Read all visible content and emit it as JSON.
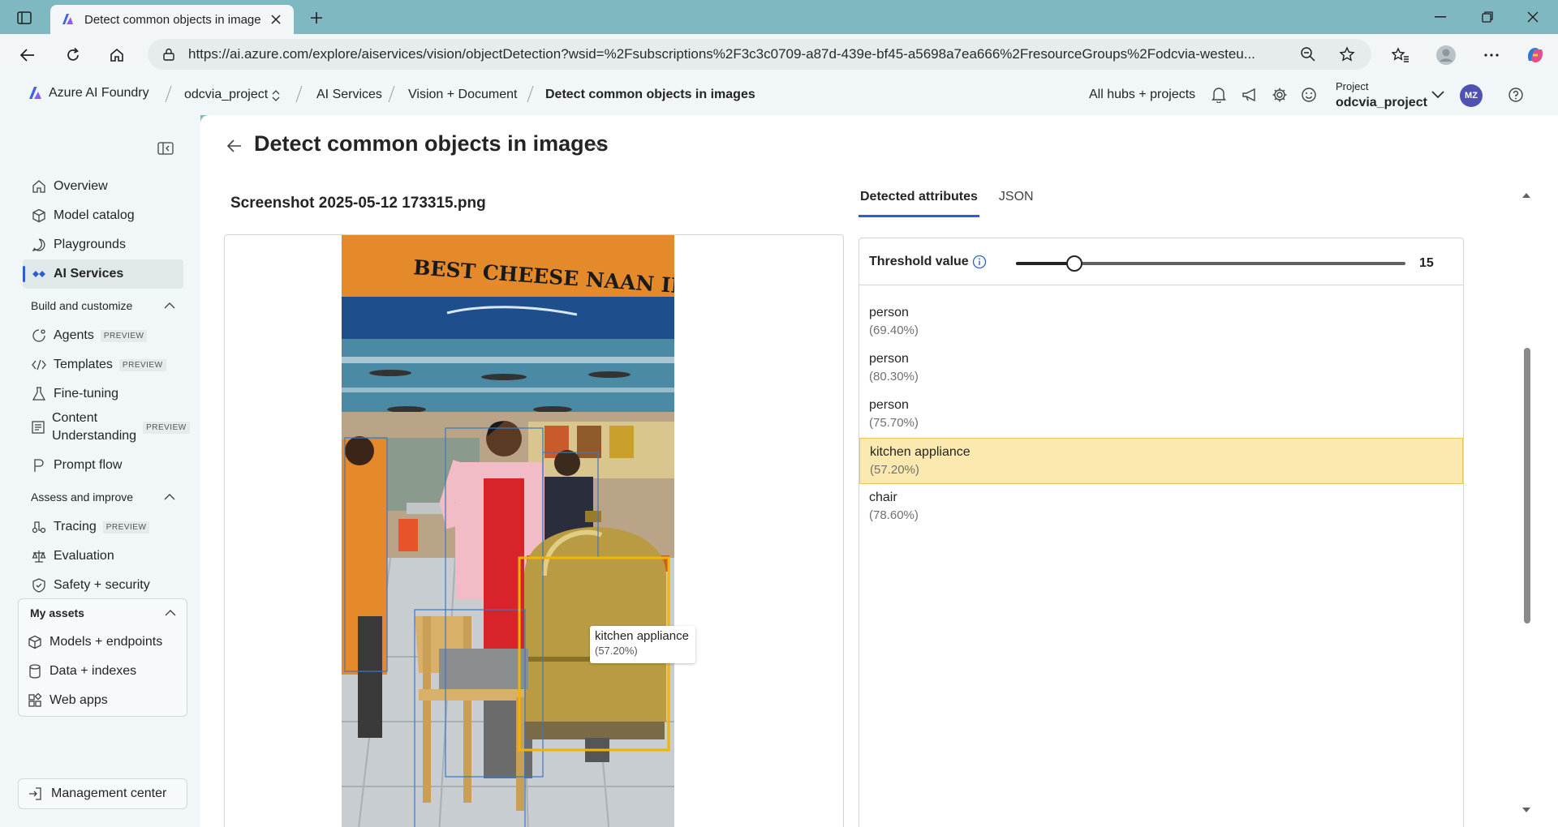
{
  "browser": {
    "tab_title": "Detect common objects in images",
    "url": "https://ai.azure.com/explore/aiservices/vision/objectDetection?wsid=%2Fsubscriptions%2F3c3c0709-a87d-439e-bf45-a5698a7ea666%2FresourceGroups%2Fodcvia-westeu..."
  },
  "header": {
    "brand": "Azure AI Foundry",
    "breadcrumbs": [
      "odcvia_project",
      "AI Services",
      "Vision + Document",
      "Detect common objects in images"
    ],
    "hubs_link": "All hubs + projects",
    "project_label": "Project",
    "project_name": "odcvia_project",
    "avatar_initials": "MZ"
  },
  "sidebar": {
    "items": [
      {
        "label": "Overview",
        "icon": "home-icon"
      },
      {
        "label": "Model catalog",
        "icon": "cube-icon"
      },
      {
        "label": "Playgrounds",
        "icon": "chat-icon"
      },
      {
        "label": "AI Services",
        "icon": "ai-services-icon",
        "active": true
      }
    ],
    "section_build": "Build and customize",
    "build_items": [
      {
        "label": "Agents",
        "badge": "PREVIEW"
      },
      {
        "label": "Templates",
        "badge": "PREVIEW"
      },
      {
        "label": "Fine-tuning"
      },
      {
        "label": "Content Understanding",
        "badge": "PREVIEW"
      },
      {
        "label": "Prompt flow"
      }
    ],
    "section_assess": "Assess and improve",
    "assess_items": [
      {
        "label": "Tracing",
        "badge": "PREVIEW"
      },
      {
        "label": "Evaluation"
      },
      {
        "label": "Safety + security"
      }
    ],
    "assets_title": "My assets",
    "assets_items": [
      {
        "label": "Models + endpoints"
      },
      {
        "label": "Data + indexes"
      },
      {
        "label": "Web apps"
      }
    ],
    "management": "Management center"
  },
  "main": {
    "title": "Detect common objects in images",
    "file_name": "Screenshot 2025-05-12 173315.png",
    "tabs": [
      "Detected attributes",
      "JSON"
    ],
    "image": {
      "sign_text": "BEST CHEESE NAAN IN TOW",
      "tooltip_label": "kitchen appliance",
      "tooltip_conf": "(57.20%)"
    },
    "threshold_label": "Threshold value",
    "threshold_value": "15",
    "threshold_fraction": 0.15,
    "attributes": [
      {
        "name": "person",
        "conf": "(69.40%)"
      },
      {
        "name": "person",
        "conf": "(80.30%)"
      },
      {
        "name": "person",
        "conf": "(75.70%)"
      },
      {
        "name": "kitchen appliance",
        "conf": "(57.20%)",
        "highlighted": true
      },
      {
        "name": "chair",
        "conf": "(78.60%)"
      }
    ]
  },
  "colors": {
    "accent": "#2b5ed6",
    "highlight": "#fce9b0",
    "box_selected": "#f2b400",
    "box_default": "#3a78c2"
  }
}
